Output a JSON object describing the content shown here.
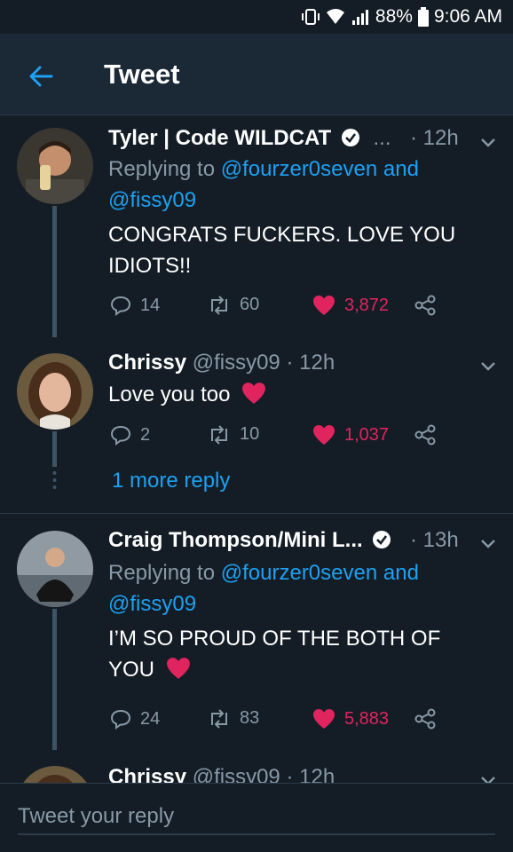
{
  "status_bar": {
    "battery": "88%",
    "time": "9:06 AM"
  },
  "header": {
    "title": "Tweet"
  },
  "tweets": [
    {
      "name": "Tyler | Code WILDCAT",
      "ellipsis": "...",
      "time": "12h",
      "replying_prefix": "Replying to",
      "replying_mention_1": "@fourzer0seven",
      "replying_and": "and",
      "replying_mention_2": "@fissy09",
      "text_line_1": "CONGRATS FUCKERS. LOVE YOU",
      "text_line_2": "IDIOTS!!",
      "replies": "14",
      "retweets": "60",
      "likes": "3,872"
    },
    {
      "name": "Chrissy",
      "handle": "@fissy09",
      "time": "12h",
      "text": "Love you too",
      "replies": "2",
      "retweets": "10",
      "likes": "1,037",
      "more_reply": "1 more reply"
    },
    {
      "name": "Craig Thompson/Mini L...",
      "time": "13h",
      "replying_prefix": "Replying to",
      "replying_mention_1": "@fourzer0seven",
      "replying_and": "and",
      "replying_mention_2": "@fissy09",
      "text_line_1": "I’M SO PROUD OF THE BOTH OF",
      "text_line_2": "YOU",
      "replies": "24",
      "retweets": "83",
      "likes": "5,883"
    },
    {
      "name": "Chrissy",
      "handle": "@fissy09",
      "time": "12h"
    }
  ],
  "reply_bar": {
    "placeholder": "Tweet your reply"
  },
  "colors": {
    "background": "#141d26",
    "accent": "#1da1f2",
    "like": "#e0245e",
    "muted": "#8899a6"
  }
}
